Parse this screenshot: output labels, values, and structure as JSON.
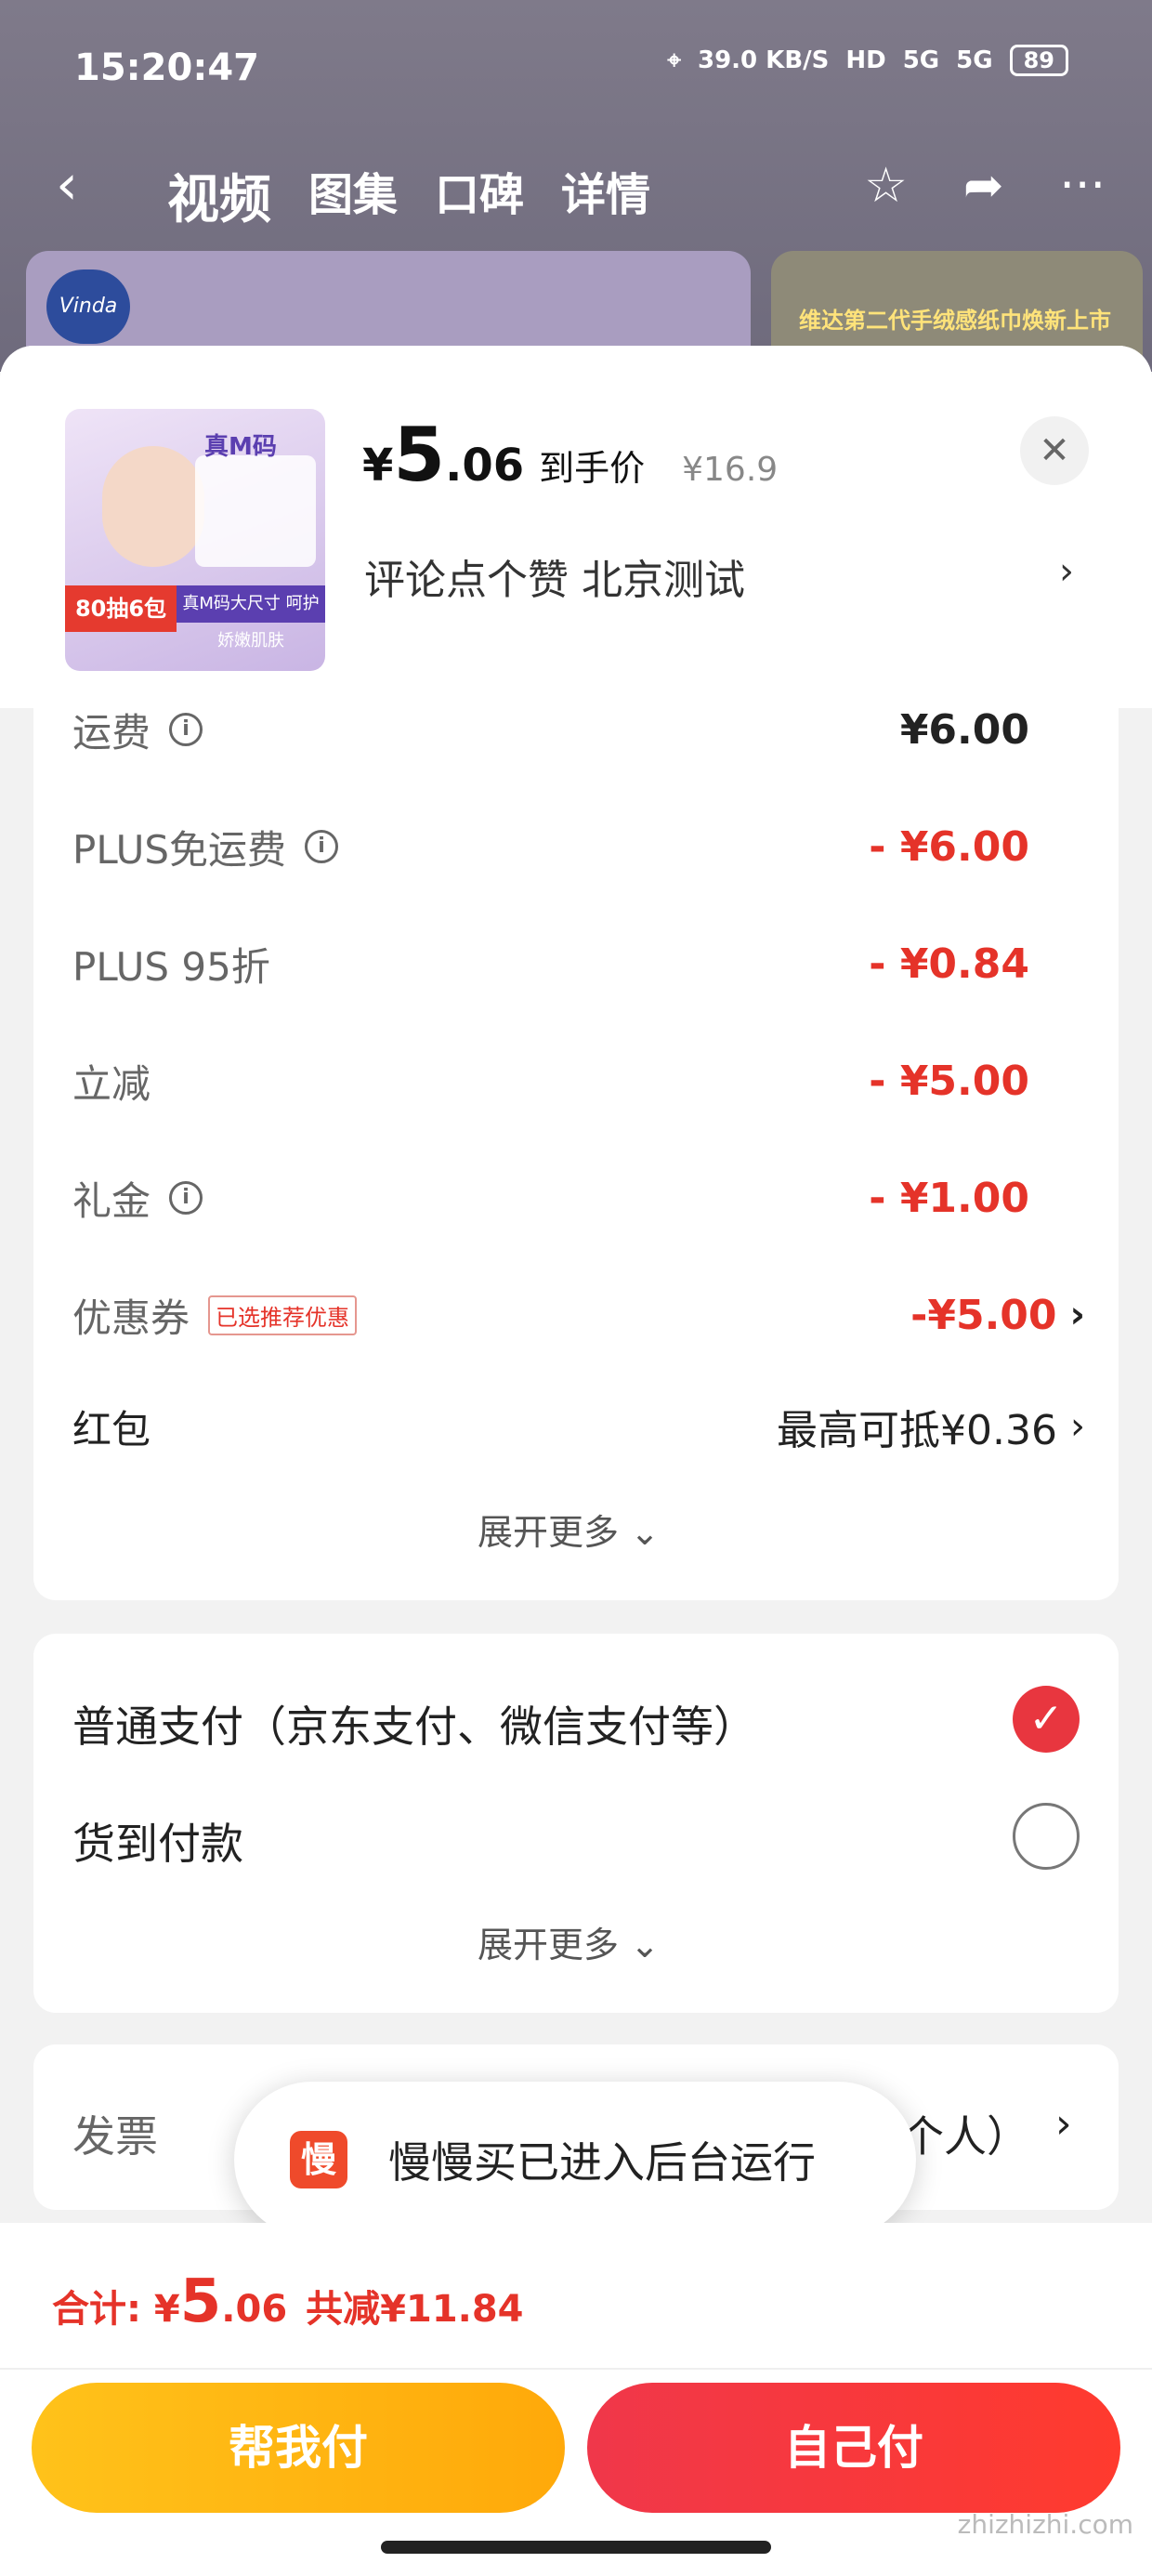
{
  "status_bar": {
    "time": "15:20:47",
    "net_speed": "39.0 KB/S",
    "hd": "HD",
    "signal1": "5G",
    "signal2": "5G",
    "battery": "89"
  },
  "nav": {
    "tabs": [
      "视频",
      "图集",
      "口碑",
      "详情"
    ]
  },
  "banner": {
    "logo": "Vinda",
    "right_text": "维达第二代手绒感纸巾焕新上市"
  },
  "product": {
    "thumb_tag": "真M码",
    "thumb_badge": "80抽6包",
    "thumb_strip": "真M码大尺寸 呵护娇嫩肌肤",
    "price_symbol": "¥",
    "price_int": "5",
    "price_dec": ".06",
    "price_label": "到手价",
    "original_price": "¥16.9",
    "address": "评论点个赞  北京测试"
  },
  "costs": [
    {
      "label": "运费",
      "value": "¥6.00",
      "info": true
    },
    {
      "label": "PLUS免运费",
      "value": "- ¥6.00",
      "info": true
    },
    {
      "label": "PLUS 95折",
      "value": "- ¥0.84",
      "info": false
    },
    {
      "label": "立减",
      "value": "- ¥5.00",
      "info": false
    },
    {
      "label": "礼金",
      "value": "- ¥1.00",
      "info": true
    },
    {
      "label": "优惠券",
      "tag": "已选推荐优惠",
      "value": "-¥5.00"
    },
    {
      "label": "红包",
      "value": "最高可抵¥0.36"
    }
  ],
  "expand_more": "展开更多",
  "payment": {
    "options": [
      "普通支付（京东支付、微信支付等）",
      "货到付款"
    ],
    "selected_index": 0,
    "expand_more": "展开更多"
  },
  "invoice": {
    "label": "发票",
    "value": "个人）"
  },
  "toast": {
    "icon_char": "慢",
    "text": "慢慢买已进入后台运行"
  },
  "bottom": {
    "total_label": "合计: ¥",
    "total_int": "5",
    "total_dec": ".06",
    "total_saved": "共减¥11.84",
    "help_pay": "帮我付",
    "self_pay": "自己付"
  },
  "watermark": "zhizhizhi.com"
}
